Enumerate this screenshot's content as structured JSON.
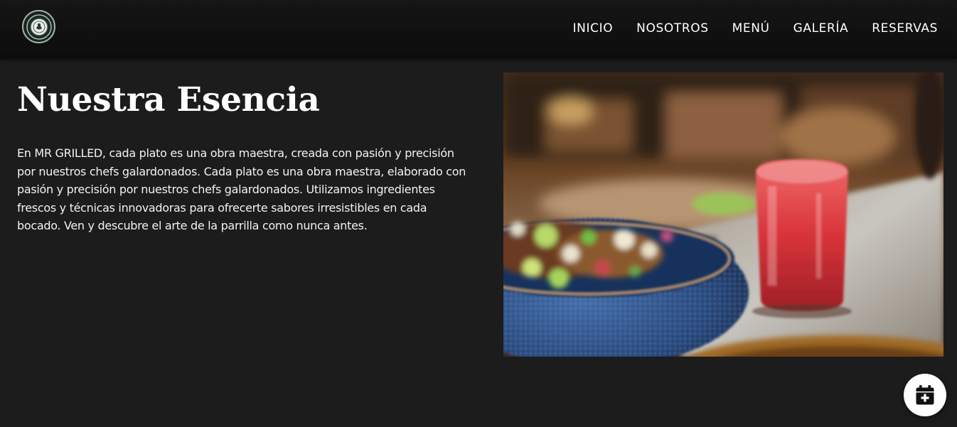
{
  "brand": {
    "logo_icon": "restaurant-seal-logo"
  },
  "nav": {
    "items": [
      {
        "label": "INICIO"
      },
      {
        "label": "NOSOTROS"
      },
      {
        "label": "MENÚ"
      },
      {
        "label": "GALERÍA"
      },
      {
        "label": "RESERVAS"
      }
    ]
  },
  "section": {
    "title": "Nuestra Esencia",
    "body": "En MR GRILLED, cada plato es una obra maestra, creada con pasión y precisión por nuestros chefs galardonados. Cada plato es una obra maestra, elaborado con pasión y precisión por nuestros chefs galardonados. Utilizamos ingredientes frescos y técnicas innovadoras para ofrecerte sabores irresistibles en cada bocado. Ven y descubre el arte de la parrilla como nunca antes.",
    "image": "blurred photo of a salad in a blue speckled bowl beside a red drink on a restaurant table"
  },
  "fab": {
    "icon": "calendar-plus-icon"
  },
  "colors": {
    "page_bg": "#1c1c1c",
    "navbar_bg": "#0f0f0f",
    "text": "#ffffff",
    "fab_bg": "#ffffff",
    "fab_icon": "#111111",
    "bowl_blue": "#2a4f8a",
    "drink_red": "#d8343a"
  }
}
